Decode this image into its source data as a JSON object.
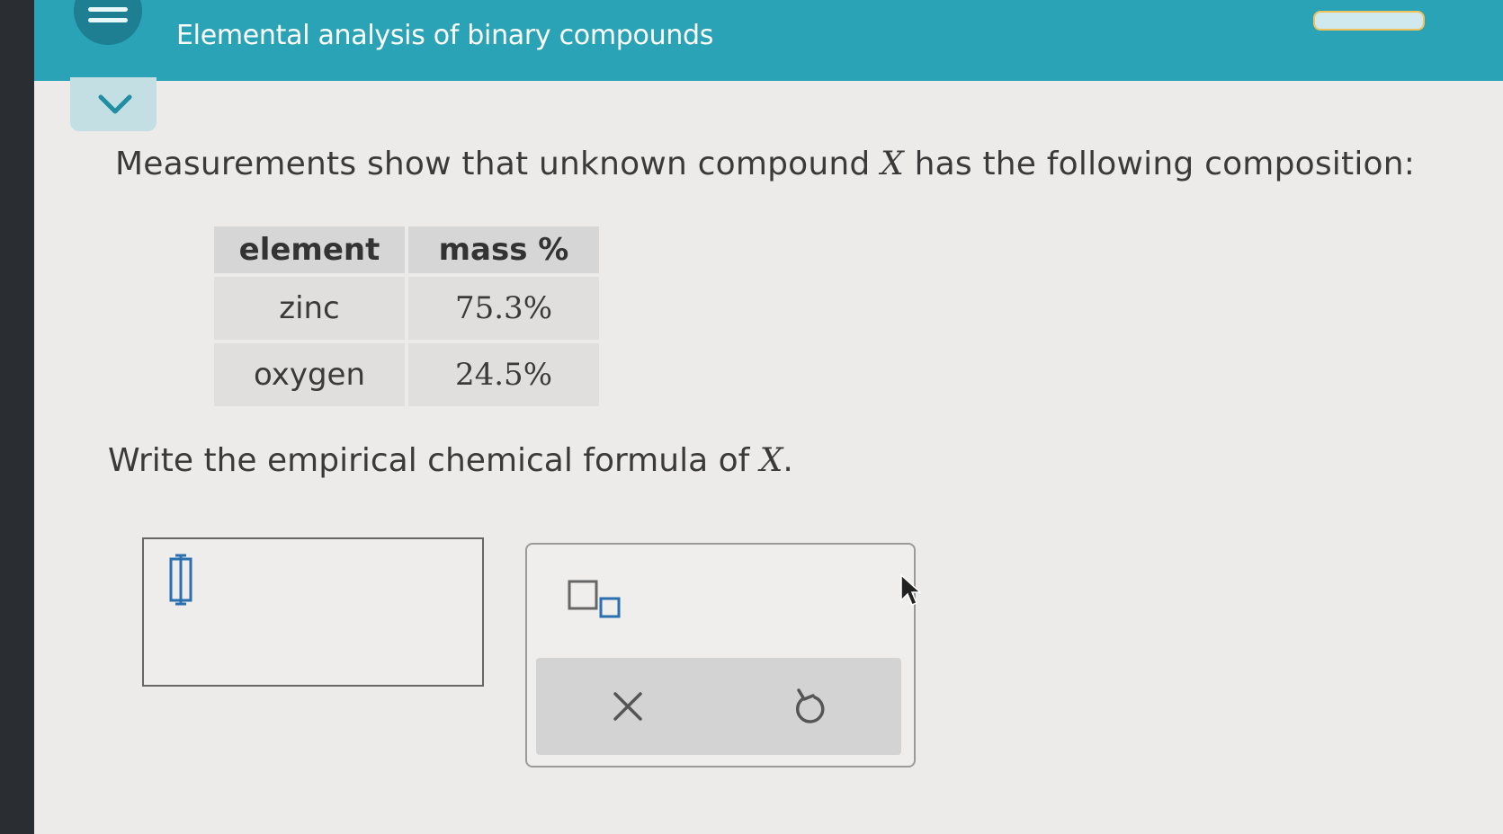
{
  "header": {
    "title": "Elemental analysis of binary compounds",
    "menu_icon": "hamburger-menu-icon",
    "accent_color": "#2aa3b6"
  },
  "collapse": {
    "icon": "chevron-down-icon"
  },
  "question": {
    "prompt_before": "Measurements show that unknown compound ",
    "variable": "X",
    "prompt_after": " has the following composition:",
    "table": {
      "headers": [
        "element",
        "mass %"
      ],
      "rows": [
        [
          "zinc",
          "75.3%"
        ],
        [
          "oxygen",
          "24.5%"
        ]
      ]
    },
    "instruction_before": "Write the empirical chemical formula of ",
    "instruction_after": "."
  },
  "answer": {
    "value": "",
    "cursor_icon": "text-caret-icon"
  },
  "keypad": {
    "subscript_icon": "subscript-template-icon",
    "clear_icon": "close-icon",
    "undo_icon": "undo-icon"
  }
}
